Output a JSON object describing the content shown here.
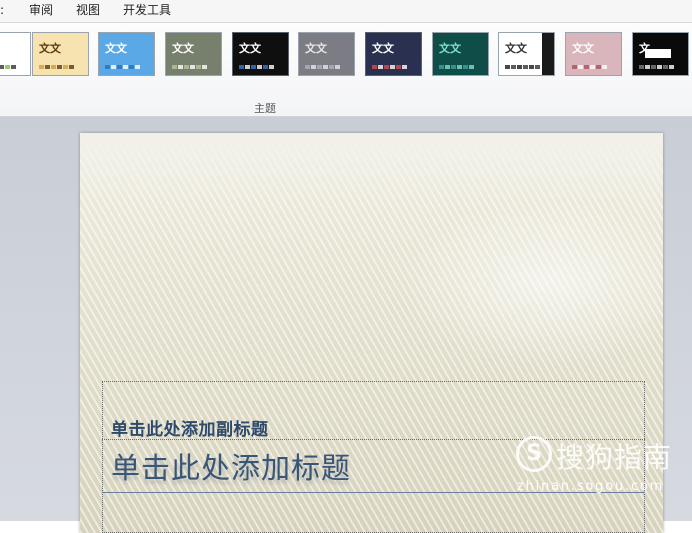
{
  "menu": {
    "items": [
      {
        "label": "审阅"
      },
      {
        "label": "视图"
      },
      {
        "label": "开发工具"
      }
    ]
  },
  "ribbon": {
    "group_label": "主题",
    "themes": [
      {
        "name": "theme-0",
        "label": "",
        "bg": "#ffffff",
        "fg": "#333333",
        "accent": "#7fbf3f"
      },
      {
        "name": "theme-1",
        "label": "文文",
        "bg": "#f6e3b0",
        "fg": "#5a3a10",
        "accent": "#d49a3a"
      },
      {
        "name": "theme-2",
        "label": "文文",
        "bg": "#5aa9e6",
        "fg": "#ffffff",
        "accent": "#2f6fb0"
      },
      {
        "name": "theme-3",
        "label": "文文",
        "bg": "#77806c",
        "fg": "#ffffff",
        "accent": "#b7c29c"
      },
      {
        "name": "theme-4",
        "label": "文文",
        "bg": "#0f0f0f",
        "fg": "#ffffff",
        "accent": "#3a7bd5"
      },
      {
        "name": "theme-5",
        "label": "文文",
        "bg": "#7c7c84",
        "fg": "#e6e6e6",
        "accent": "#b0b0b8"
      },
      {
        "name": "theme-6",
        "label": "文文",
        "bg": "#2a3150",
        "fg": "#ffffff",
        "accent": "#d05050"
      },
      {
        "name": "theme-7",
        "label": "文文",
        "bg": "#0f4d48",
        "fg": "#7fe0c8",
        "accent": "#3fa0a0"
      },
      {
        "name": "theme-8",
        "label": "文文",
        "bg": "#ffffff",
        "fg": "#333333",
        "accent": "#1a1a1a"
      },
      {
        "name": "theme-9",
        "label": "文文",
        "bg": "#d8b6bc",
        "fg": "#ffffff",
        "accent": "#a85060"
      },
      {
        "name": "theme-10",
        "label": "文",
        "bg": "#0a0a0a",
        "fg": "#ffffff",
        "accent": "#808080"
      }
    ]
  },
  "slide": {
    "subtitle_placeholder": "单击此处添加副标题",
    "title_placeholder": "单击此处添加标题"
  },
  "watermark": {
    "logo": "S",
    "text": "搜狗指南",
    "url": "zhinan.sogou.com"
  }
}
